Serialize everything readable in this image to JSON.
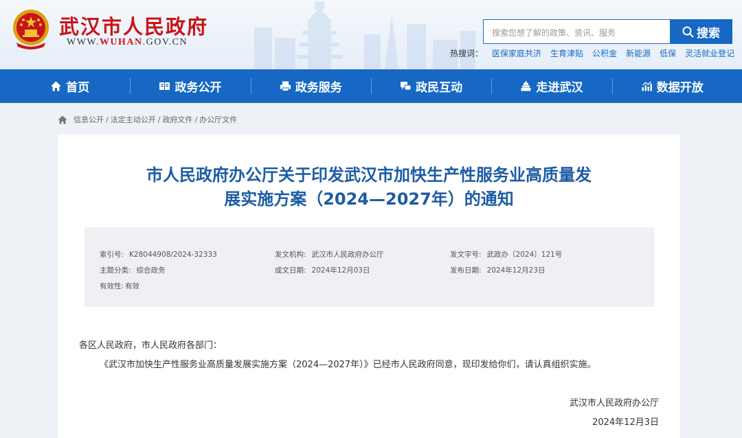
{
  "header": {
    "site_title": "武汉市人民政府",
    "site_url_prefix": "WWW.",
    "site_url_highlight": "WUHAN",
    "site_url_suffix": ".GOV.CN",
    "search": {
      "placeholder": "搜索您想了解的政策、资讯、服务",
      "button_label": "搜索"
    },
    "hot_label": "热搜词：",
    "hot_words": [
      "医保家庭共济",
      "生育津贴",
      "公积金",
      "新能源",
      "低保",
      "灵活就业登记"
    ]
  },
  "nav": {
    "items": [
      {
        "label": "首页",
        "icon": "home-icon"
      },
      {
        "label": "政务公开",
        "icon": "book-icon"
      },
      {
        "label": "政务服务",
        "icon": "printer-icon"
      },
      {
        "label": "政民互动",
        "icon": "chat-icon"
      },
      {
        "label": "走进武汉",
        "icon": "building-icon"
      },
      {
        "label": "数据开放",
        "icon": "chart-icon"
      }
    ]
  },
  "breadcrumb": [
    "信息公开",
    "法定主动公开",
    "政府文件",
    "办公厅文件"
  ],
  "document": {
    "title_line1": "市人民政府办公厅关于印发武汉市加快生产性服务业高质量发",
    "title_line2": "展实施方案（2024—2027年）的通知",
    "meta": {
      "index_no": {
        "key": "索引号:",
        "value": "K28044908/2024-32333"
      },
      "issuer": {
        "key": "发文机构:",
        "value": "武汉市人民政府办公厅"
      },
      "doc_no": {
        "key": "发文字号:",
        "value": "武政办〔2024〕121号"
      },
      "category": {
        "key": "主题分类:",
        "value": "综合政务"
      },
      "created": {
        "key": "成文日期:",
        "value": "2024年12月03日"
      },
      "published": {
        "key": "发布日期:",
        "value": "2024年12月23日"
      },
      "validity": {
        "key": "有效性:",
        "value": "有效"
      }
    },
    "salutation": "各区人民政府，市人民政府各部门：",
    "paragraph": "《武汉市加快生产性服务业高质量发展实施方案（2024—2027年）》已经市人民政府同意，现印发给你们，请认真组织实施。",
    "signature": "武汉市人民政府办公厅",
    "date": "2024年12月3日"
  }
}
